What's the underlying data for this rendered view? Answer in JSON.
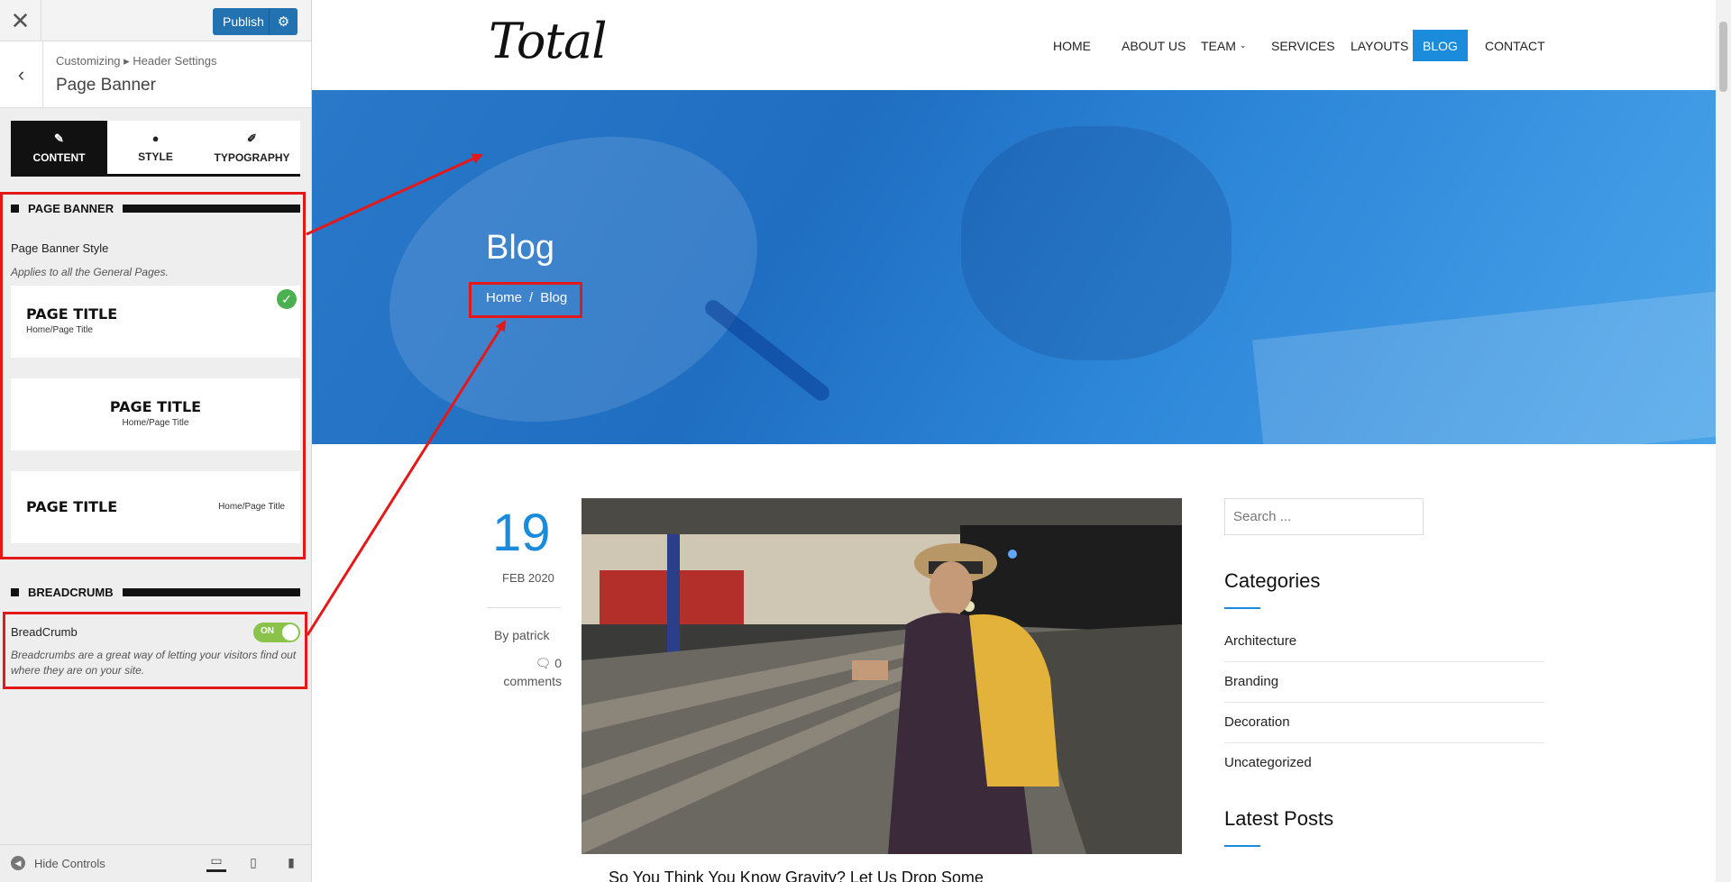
{
  "customizer": {
    "publish_label": "Publish",
    "breadcrumb": "Customizing ▸ Header Settings",
    "section_title": "Page Banner",
    "tabs": [
      {
        "label": "CONTENT",
        "icon": "edit-icon"
      },
      {
        "label": "STYLE",
        "icon": "palette-icon"
      },
      {
        "label": "TYPOGRAPHY",
        "icon": "pen-icon"
      }
    ],
    "page_banner_heading": "PAGE BANNER",
    "banner_style_label": "Page Banner Style",
    "banner_style_desc": "Applies to all the General Pages.",
    "style_options": [
      {
        "title": "PAGE TITLE",
        "crumb": "Home/Page Title",
        "selected": true
      },
      {
        "title": "PAGE TITLE",
        "crumb": "Home/Page Title",
        "selected": false
      },
      {
        "title": "PAGE TITLE",
        "crumb": "Home/Page Title",
        "selected": false
      }
    ],
    "breadcrumb_heading": "BREADCRUMB",
    "breadcrumb_label": "BreadCrumb",
    "breadcrumb_toggle": "ON",
    "breadcrumb_desc": "Breadcrumbs are a great way of letting your visitors find out where they are on your site.",
    "hide_controls": "Hide Controls",
    "accent": "#2271b1"
  },
  "site": {
    "logo": "Total",
    "nav": [
      "HOME",
      "ABOUT US",
      "TEAM",
      "SERVICES",
      "LAYOUTS",
      "BLOG",
      "CONTACT"
    ],
    "nav_active": "BLOG",
    "banner_title": "Blog",
    "bc_home": "Home",
    "bc_sep": "/",
    "bc_current": "Blog",
    "post": {
      "day": "19",
      "month_year": "FEB 2020",
      "by": "By patrick",
      "comments_count": "0",
      "comments_label": "comments",
      "title": "So You Think You Know Gravity? Let Us Drop Some"
    },
    "search_placeholder": "Search ...",
    "categories_title": "Categories",
    "categories": [
      "Architecture",
      "Branding",
      "Decoration",
      "Uncategorized"
    ],
    "latest_posts_title": "Latest Posts",
    "accent": "#1a8cdb"
  }
}
